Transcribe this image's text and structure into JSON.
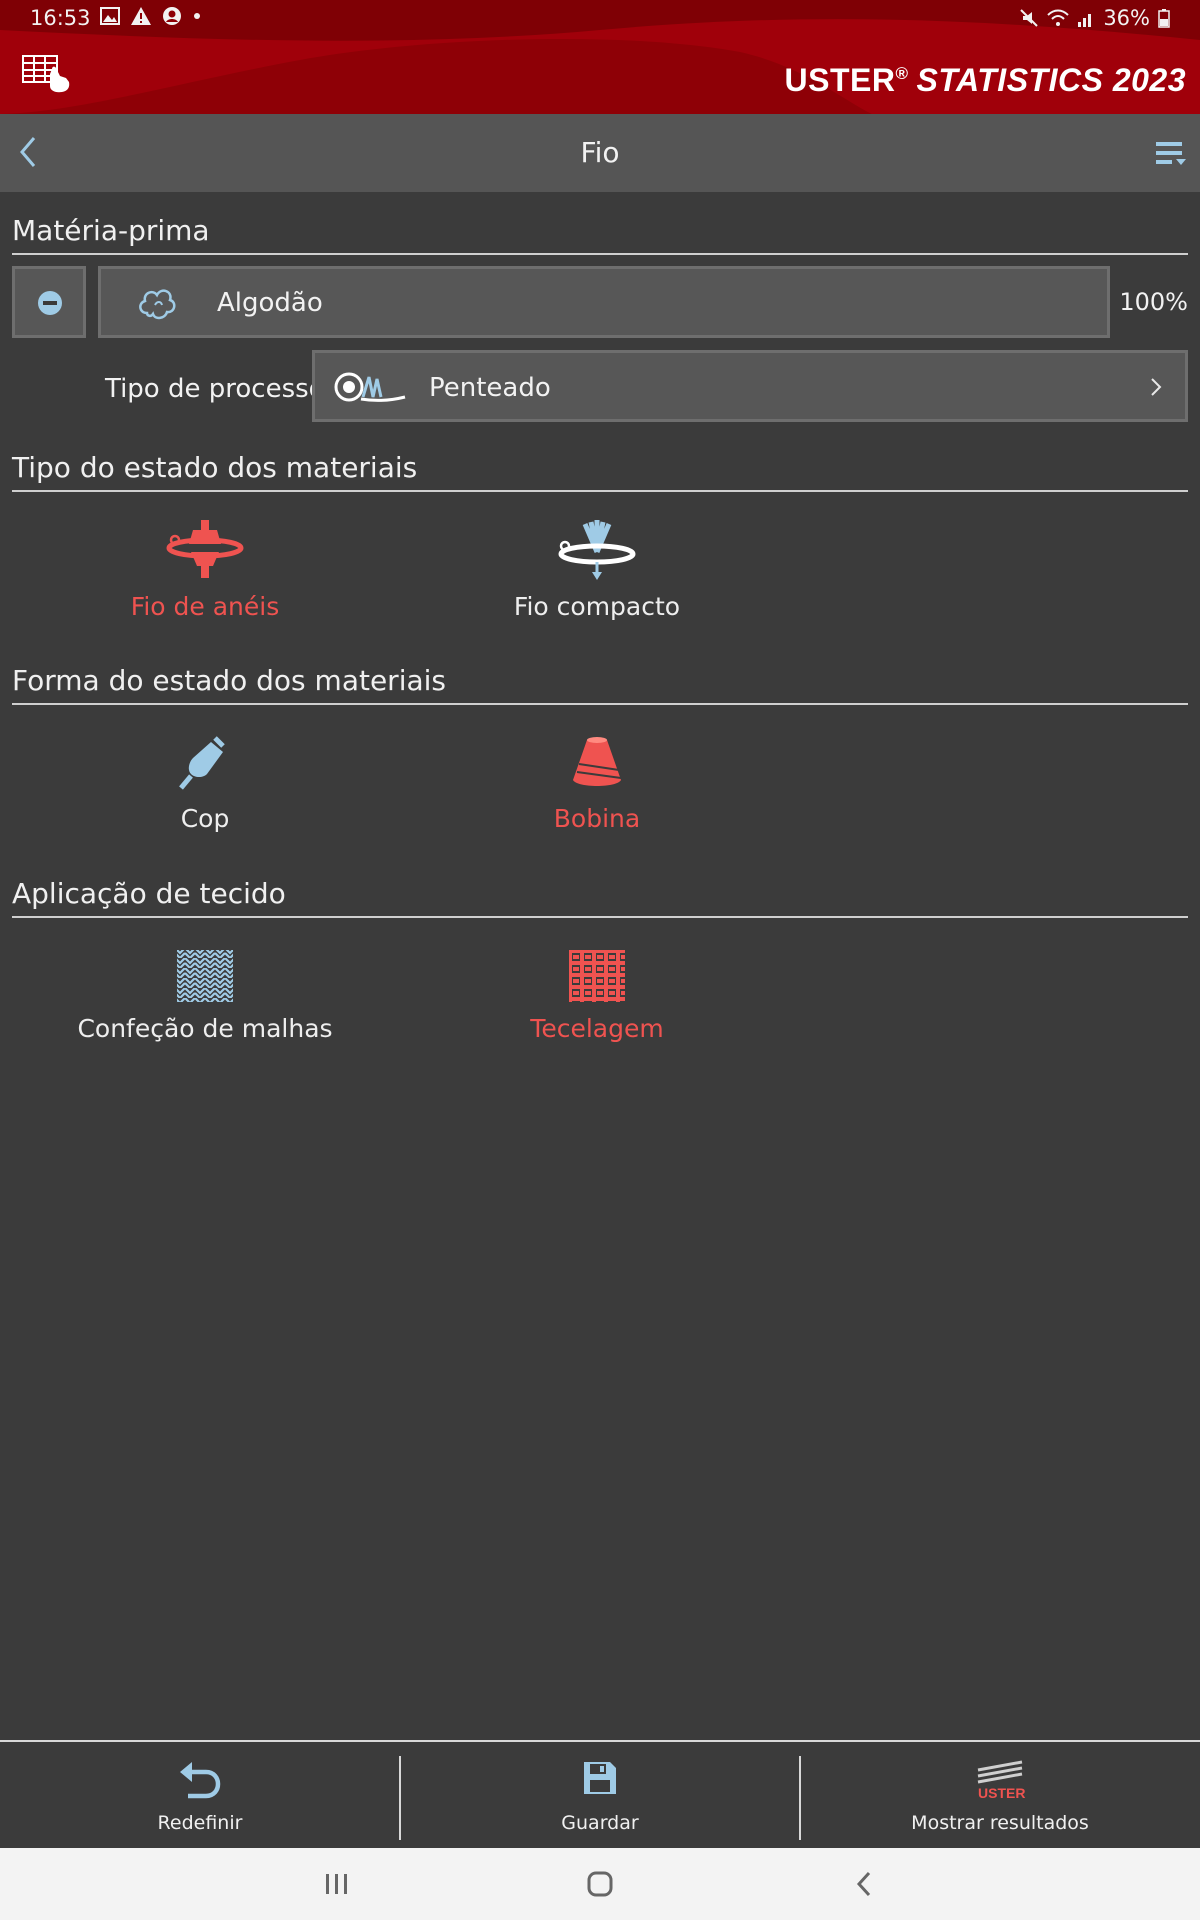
{
  "status_bar": {
    "time": "16:53",
    "battery": "36%",
    "left_icons": [
      "image-icon",
      "warning-icon",
      "account-icon",
      "dot-icon"
    ],
    "right_icons": [
      "mute-icon",
      "wifi-icon",
      "signal-icon",
      "battery-icon"
    ]
  },
  "brand": {
    "name": "USTER",
    "reg": "®",
    "product": "STATISTICS 2023"
  },
  "titlebar": {
    "title": "Fio"
  },
  "raw_material": {
    "section_title": "Matéria-prima",
    "material": "Algodão",
    "percent": "100%",
    "process_label": "Tipo de processo",
    "process_value": "Penteado"
  },
  "material_type": {
    "section_title": "Tipo do estado dos materiais",
    "options": [
      {
        "label": "Fio de anéis",
        "active": true
      },
      {
        "label": "Fio compacto",
        "active": false
      }
    ]
  },
  "material_form": {
    "section_title": "Forma do estado dos materiais",
    "options": [
      {
        "label": "Cop",
        "active": false
      },
      {
        "label": "Bobina",
        "active": true
      }
    ]
  },
  "fabric_application": {
    "section_title": "Aplicação de tecido",
    "options": [
      {
        "label": "Confeção de malhas",
        "active": false
      },
      {
        "label": "Tecelagem",
        "active": true
      }
    ]
  },
  "toolbar": {
    "reset_label": "Redefinir",
    "save_label": "Guardar",
    "results_label": "Mostrar resultados",
    "results_logo_text": "USTER"
  },
  "colors": {
    "brand_red": "#8e0006",
    "active_red": "#ef5350",
    "icon_blue": "#9fcbe6",
    "background": "#3b3b3b",
    "titlebar": "#555555"
  }
}
